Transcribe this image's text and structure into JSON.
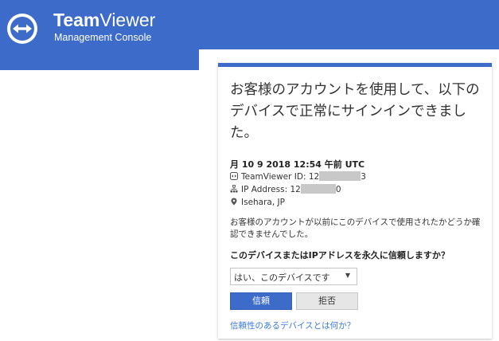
{
  "header": {
    "brand_bold": "Team",
    "brand_light": "Viewer",
    "subtitle": "Management Console",
    "color": "#3d6bc9"
  },
  "card": {
    "headline": "お客様のアカウントを使用して、以下のデバイスで正常にサインインできました。",
    "date": "月 10 9 2018 12:54 午前 UTC",
    "teamviewer_id": {
      "label": "TeamViewer ID:",
      "visible_prefix": "12",
      "visible_suffix": "3",
      "icon": "teamviewer-icon"
    },
    "ip_address": {
      "label": "IP Address:",
      "visible_prefix": "12",
      "visible_suffix": "0",
      "icon": "network-icon"
    },
    "location": {
      "text": "Isehara, JP",
      "icon": "location-pin-icon"
    },
    "notice": "お客様のアカウントが以前にこのデバイスで使用されたかどうか確認できませんでした。",
    "question": "このデバイスまたはIPアドレスを永久に信頼しますか？",
    "select": {
      "selected": "はい、このデバイスです",
      "arrow": "▼"
    },
    "trust_button": "信頼",
    "reject_button": "拒否",
    "help_link": "信頼性のあるデバイスとは何か？"
  }
}
